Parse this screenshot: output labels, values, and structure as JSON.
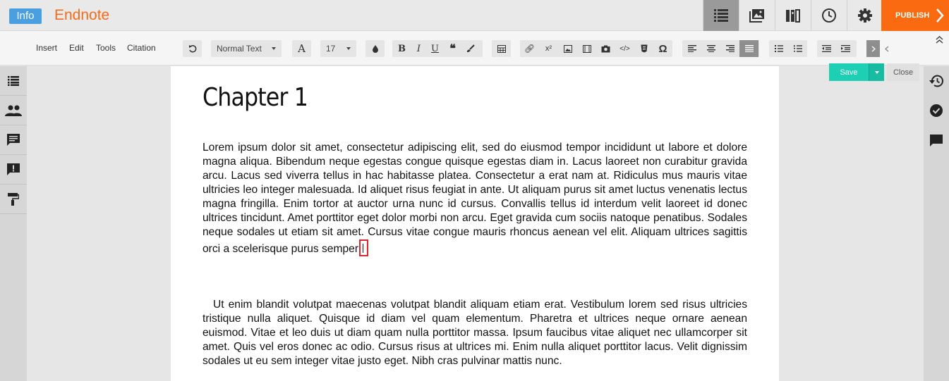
{
  "header": {
    "info_label": "Info",
    "app_title": "Endnote",
    "publish_label": "PUBLISH",
    "brand_color": "#f26c1e",
    "publish_color": "#fa6a10",
    "icons": [
      "outline-icon",
      "images-icon",
      "library-icon",
      "history-clock-icon",
      "gear-icon"
    ]
  },
  "toolbar": {
    "menus": [
      "Insert",
      "Edit",
      "Tools",
      "Citation"
    ],
    "paragraph_style": "Normal Text",
    "font_size": "17"
  },
  "actions": {
    "save_label": "Save",
    "close_label": "Close",
    "save_color": "#1dcfb3"
  },
  "document": {
    "title": "Chapter 1",
    "paragraph1": "Lorem ipsum dolor sit amet, consectetur adipiscing elit, sed do eiusmod tempor incididunt ut labore et dolore magna aliqua. Bibendum neque egestas congue quisque egestas diam in. Lacus laoreet non curabitur gravida arcu. Lacus sed viverra tellus in hac habitasse platea. Consectetur a erat nam at. Ridiculus mus mauris vitae ultricies leo integer malesuada. Id aliquet risus feugiat in ante. Ut aliquam purus sit amet luctus venenatis lectus magna fringilla. Enim tortor at auctor urna nunc id cursus. Convallis tellus id interdum velit laoreet id donec ultrices tincidunt. Amet porttitor eget dolor morbi non arcu. Eget gravida cum sociis natoque penatibus. Sodales neque sodales ut etiam sit amet. Cursus vitae congue mauris rhoncus aenean vel elit. Aliquam ultrices sagittis orci a scelerisque purus semper",
    "paragraph2": "Ut enim blandit volutpat maecenas volutpat blandit aliquam etiam erat. Vestibulum lorem sed risus ultricies tristique nulla aliquet. Quisque id diam vel quam elementum. Pharetra et ultrices neque ornare aenean euismod. Vitae et leo duis ut diam quam nulla porttitor massa. Ipsum faucibus vitae aliquet nec ullamcorper sit amet. Quis vel eros donec ac odio. Cursus risus at ultrices mi. Enim nulla aliquet porttitor lacus. Velit dignissim sodales ut eu sem integer vitae justo eget. Nibh cras pulvinar mattis nunc."
  },
  "left_rail": [
    "list-icon",
    "people-icon",
    "comment-icon",
    "alert-comment-icon",
    "paint-roller-icon"
  ],
  "right_rail": [
    "history-icon",
    "check-circle-icon",
    "chat-icon"
  ]
}
